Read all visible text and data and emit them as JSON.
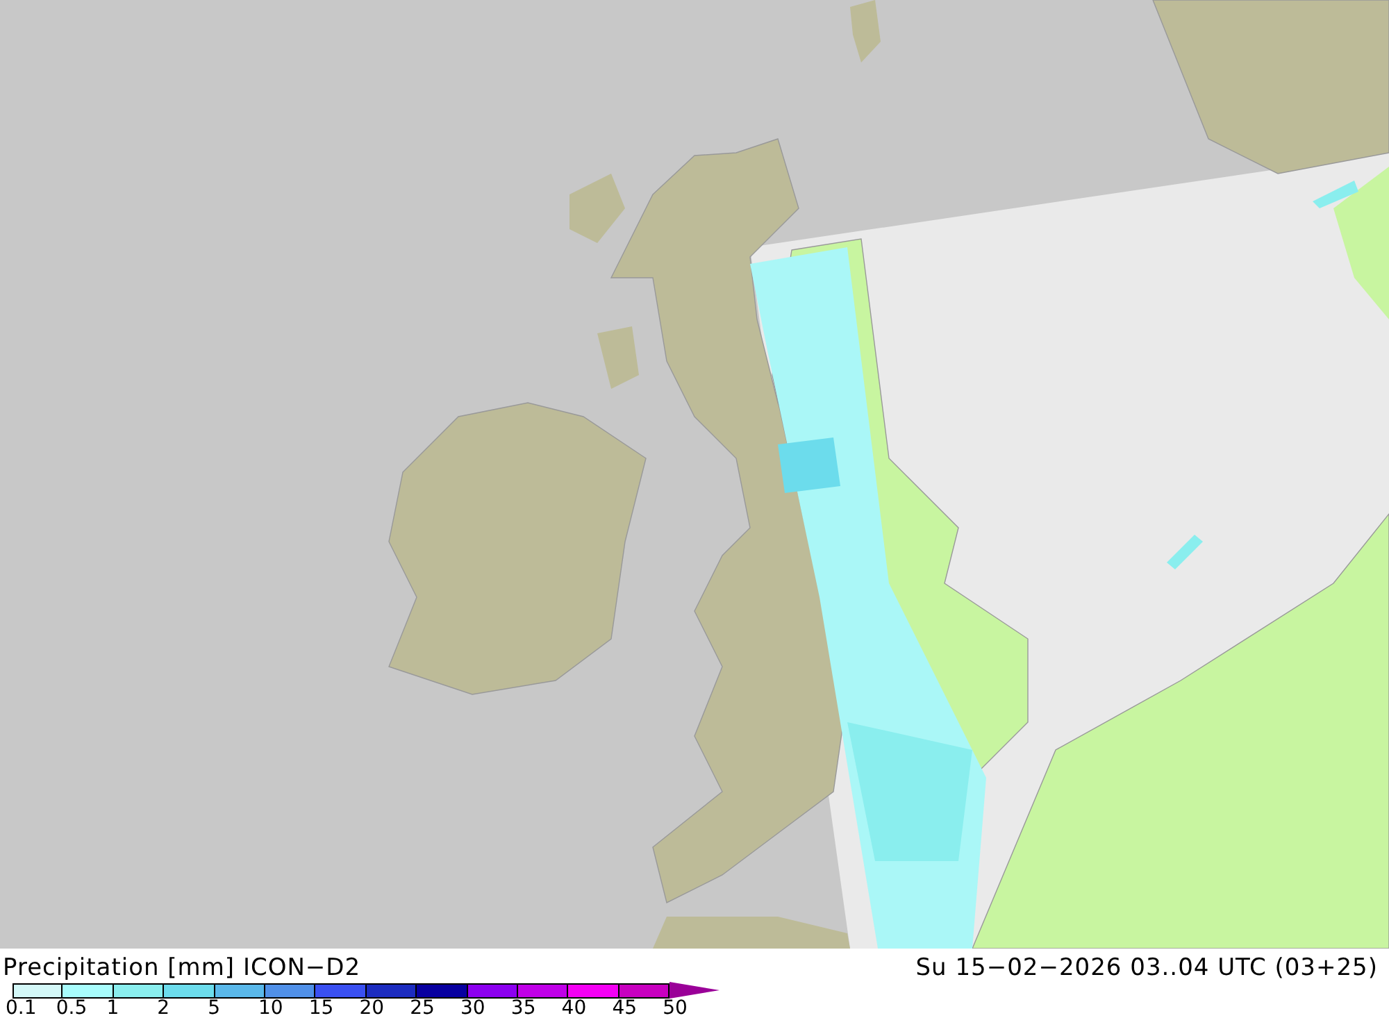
{
  "legend": {
    "title": "Precipitation [mm] ICON−D2",
    "timestamp": "Su 15−02−2026 03..04 UTC (03+25)",
    "bins": [
      {
        "color": "#d4f8f8"
      },
      {
        "color": "#a8fcfc"
      },
      {
        "color": "#8aeeee"
      },
      {
        "color": "#6cdcec"
      },
      {
        "color": "#5ab8ea"
      },
      {
        "color": "#5090e8"
      },
      {
        "color": "#3a50f2"
      },
      {
        "color": "#1c2cc0"
      },
      {
        "color": "#0800a0"
      },
      {
        "color": "#8c00f0"
      },
      {
        "color": "#c000e8"
      },
      {
        "color": "#f400f4"
      },
      {
        "color": "#c800c0"
      }
    ],
    "arrow": {
      "color": "#9a0098"
    },
    "labels": [
      "0.1",
      "0.5",
      "1",
      "2",
      "5",
      "10",
      "15",
      "20",
      "25",
      "30",
      "35",
      "40",
      "45",
      "50"
    ]
  }
}
